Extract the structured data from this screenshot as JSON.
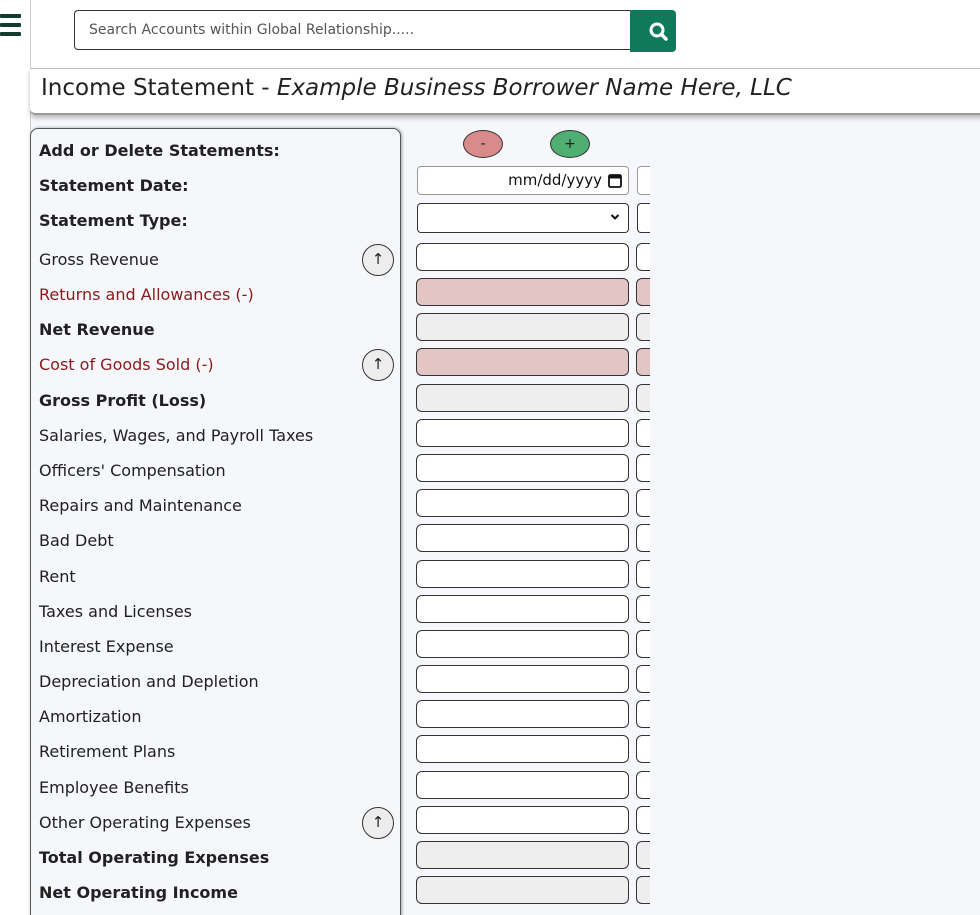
{
  "search": {
    "placeholder": "Search Accounts within Global Relationship....."
  },
  "header": {
    "title_prefix": "Income Statement - ",
    "borrower_name": "Example Business Borrower Name Here, LLC"
  },
  "controls": {
    "remove_label": "-",
    "add_label": "+",
    "date_placeholder": "mm/dd/yyyy",
    "arrow_label": "↑"
  },
  "colors": {
    "brand_green": "#0e7a5a",
    "deduction_red": "#8b1a1a",
    "deduction_field": "#e2c6c6",
    "calculated_field": "#eeeeee"
  },
  "rows": [
    {
      "label": "Add or Delete Statements:",
      "bold": true
    },
    {
      "label": "Statement Date:",
      "bold": true
    },
    {
      "label": "Statement Type:",
      "bold": true
    },
    {
      "label": "Gross Revenue",
      "field": "white",
      "arrow": true
    },
    {
      "label": "Returns and Allowances (-)",
      "red": true,
      "field": "red"
    },
    {
      "label": "Net Revenue",
      "bold": true,
      "field": "grey"
    },
    {
      "label": "Cost of Goods Sold (-)",
      "red": true,
      "field": "red",
      "arrow": true
    },
    {
      "label": "Gross Profit (Loss)",
      "bold": true,
      "field": "grey"
    },
    {
      "label": "Salaries, Wages, and Payroll Taxes",
      "field": "white"
    },
    {
      "label": "Officers' Compensation",
      "field": "white"
    },
    {
      "label": "Repairs and Maintenance",
      "field": "white"
    },
    {
      "label": "Bad Debt",
      "field": "white"
    },
    {
      "label": "Rent",
      "field": "white"
    },
    {
      "label": "Taxes and Licenses",
      "field": "white"
    },
    {
      "label": "Interest Expense",
      "field": "white"
    },
    {
      "label": "Depreciation and Depletion",
      "field": "white"
    },
    {
      "label": "Amortization",
      "field": "white"
    },
    {
      "label": "Retirement Plans",
      "field": "white"
    },
    {
      "label": "Employee Benefits",
      "field": "white"
    },
    {
      "label": "Other Operating Expenses",
      "field": "white",
      "arrow": true
    },
    {
      "label": "Total Operating Expenses",
      "bold": true,
      "field": "grey"
    },
    {
      "label": "Net Operating Income",
      "bold": true,
      "field": "grey"
    }
  ]
}
